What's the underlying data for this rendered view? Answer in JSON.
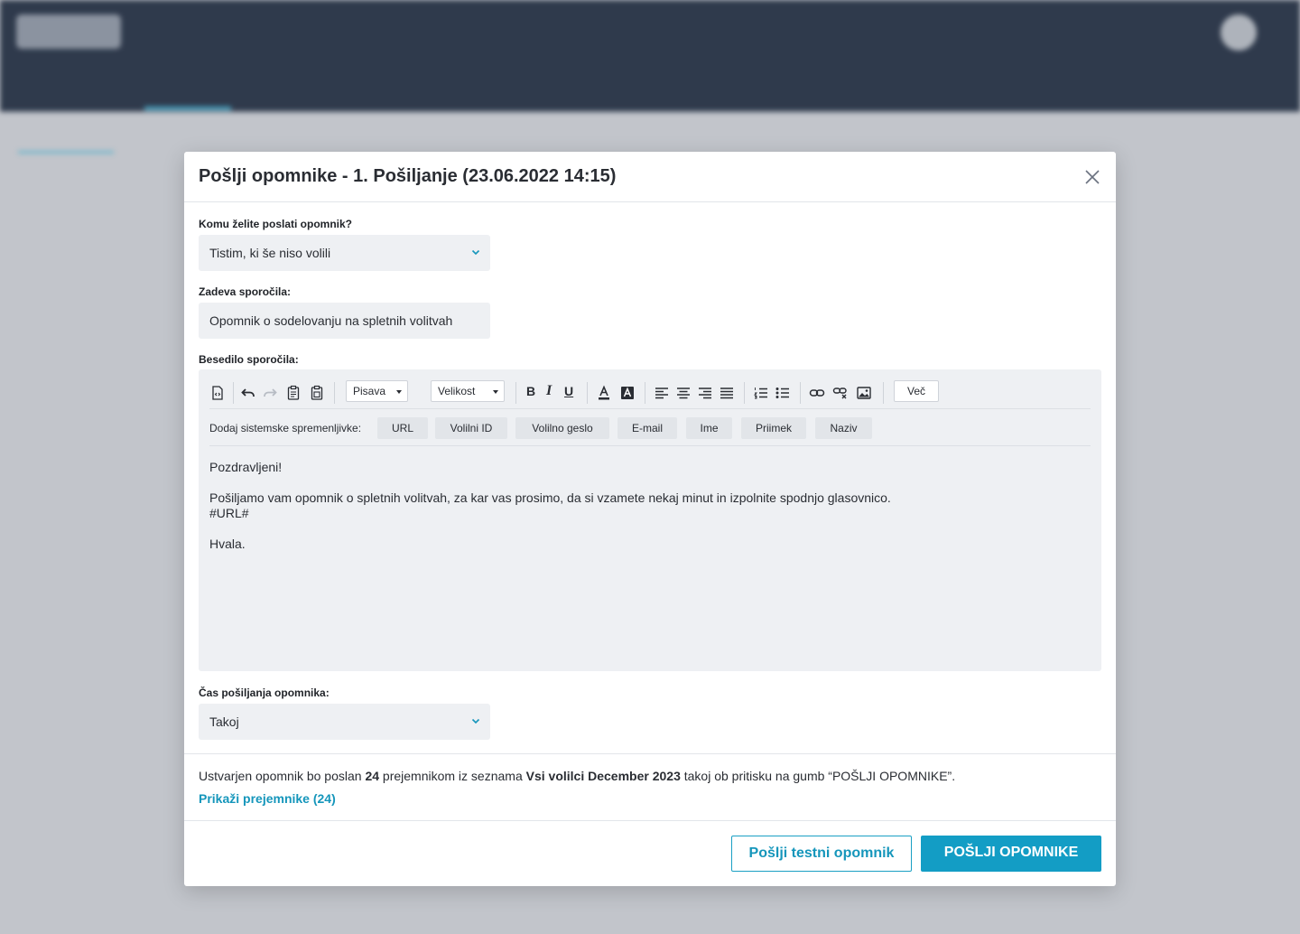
{
  "modal": {
    "title": "Pošlji opomnike - 1. Pošiljanje (23.06.2022 14:15)",
    "recipient_label": "Komu želite poslati opomnik?",
    "recipient_value": "Tistim, ki še niso volili",
    "subject_label": "Zadeva sporočila:",
    "subject_value": "Opomnik o sodelovanju na spletnih volitvah",
    "body_label": "Besedilo sporočila:",
    "toolbar": {
      "font_label": "Pisava",
      "size_label": "Velikost",
      "bold": "B",
      "italic": "I",
      "underline": "U",
      "more_label": "Več"
    },
    "variables": {
      "label": "Dodaj sistemske spremenljivke:",
      "items": [
        "URL",
        "Volilni ID",
        "Volilno geslo",
        "E-mail",
        "Ime",
        "Priimek",
        "Naziv"
      ]
    },
    "body": {
      "line1": "Pozdravljeni!",
      "line2": "Pošiljamo vam opomnik o spletnih volitvah, za kar vas prosimo, da si vzamete nekaj minut in izpolnite spodnjo glasovnico.",
      "line3": "#URL#",
      "line4": "Hvala."
    },
    "timing_label": "Čas pošiljanja opomnika:",
    "timing_value": "Takoj",
    "summary": {
      "part1": "Ustvarjen opomnik bo poslan ",
      "count": "24",
      "part2": " prejemnikom iz seznama ",
      "list_name": "Vsi volilci December 2023",
      "part3": " takoj ob pritisku na gumb “POŠLJI OPOMNIKE”."
    },
    "show_recipients": "Prikaži prejemnike (24)",
    "test_button": "Pošlji testni opomnik",
    "send_button": "POŠLJI OPOMNIKE"
  },
  "colors": {
    "accent": "#139dc5",
    "overlay": "#c2c5cb",
    "topbar": "#2f3a4c"
  }
}
